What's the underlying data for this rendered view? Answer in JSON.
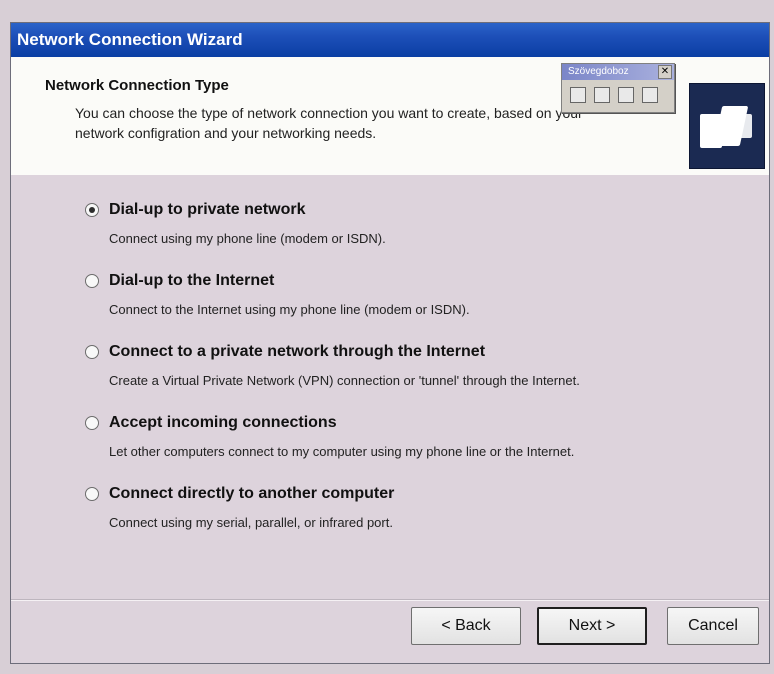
{
  "window": {
    "title": "Network Connection Wizard"
  },
  "header": {
    "title": "Network Connection Type",
    "description": "You can choose the type of network connection you want to create, based on your network configration and your networking needs."
  },
  "floating_toolbar": {
    "title": "Szövegdoboz",
    "close_symbol": "✕",
    "icons": [
      "link-icon",
      "format-icon",
      "text-icon",
      "layout-icon"
    ]
  },
  "options": [
    {
      "label": "Dial-up to private network",
      "description": "Connect using my phone line (modem or ISDN).",
      "selected": true
    },
    {
      "label": "Dial-up to the Internet",
      "description": "Connect to the Internet using my phone line (modem or ISDN).",
      "selected": false
    },
    {
      "label": "Connect to a private network through the Internet",
      "description": "Create a Virtual Private Network (VPN) connection or 'tunnel' through the Internet.",
      "selected": false
    },
    {
      "label": "Accept incoming connections",
      "description": "Let other computers connect to my computer using my phone line or the Internet.",
      "selected": false
    },
    {
      "label": "Connect directly to another computer",
      "description": "Connect using my serial, parallel, or infrared port.",
      "selected": false
    }
  ],
  "buttons": {
    "back": "< Back",
    "next": "Next >",
    "cancel": "Cancel"
  }
}
